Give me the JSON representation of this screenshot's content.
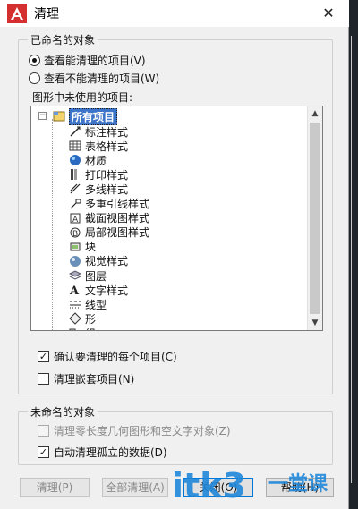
{
  "window": {
    "title": "清理",
    "close_symbol": "✕"
  },
  "named_objects": {
    "legend": "已命名的对象",
    "radio_purgeable": "查看能清理的项目(V)",
    "radio_unpurgeable": "查看不能清理的项目(W)",
    "unused_label": "图形中未使用的项目:",
    "tree": {
      "root": "所有项目",
      "items": [
        {
          "label": "标注样式",
          "icon": "dimension-style-icon"
        },
        {
          "label": "表格样式",
          "icon": "table-style-icon"
        },
        {
          "label": "材质",
          "icon": "material-icon"
        },
        {
          "label": "打印样式",
          "icon": "plot-style-icon"
        },
        {
          "label": "多线样式",
          "icon": "multiline-style-icon"
        },
        {
          "label": "多重引线样式",
          "icon": "multileader-style-icon"
        },
        {
          "label": "截面视图样式",
          "icon": "section-view-style-icon"
        },
        {
          "label": "局部视图样式",
          "icon": "detail-view-style-icon"
        },
        {
          "label": "块",
          "icon": "block-icon"
        },
        {
          "label": "视觉样式",
          "icon": "visual-style-icon"
        },
        {
          "label": "图层",
          "icon": "layer-icon"
        },
        {
          "label": "文字样式",
          "icon": "text-style-icon"
        },
        {
          "label": "线型",
          "icon": "linetype-icon"
        },
        {
          "label": "形",
          "icon": "shape-icon"
        },
        {
          "label": "组",
          "icon": "group-icon"
        }
      ]
    },
    "confirm_each": "确认要清理的每个项目(C)",
    "purge_nested": "清理嵌套项目(N)"
  },
  "unnamed_objects": {
    "legend": "未命名的对象",
    "zero_length": "清理零长度几何图形和空文字对象(Z)",
    "orphaned_data": "自动清理孤立的数据(D)"
  },
  "buttons": {
    "purge": "清理(P)",
    "purge_all": "全部清理(A)",
    "close": "关闭(O)",
    "help": "帮助(H)"
  },
  "watermark": {
    "brand": "itk3",
    "suffix": "一堂课"
  },
  "colors": {
    "selection": "#3b74c9",
    "watermark_blue": "#1f86d8"
  }
}
